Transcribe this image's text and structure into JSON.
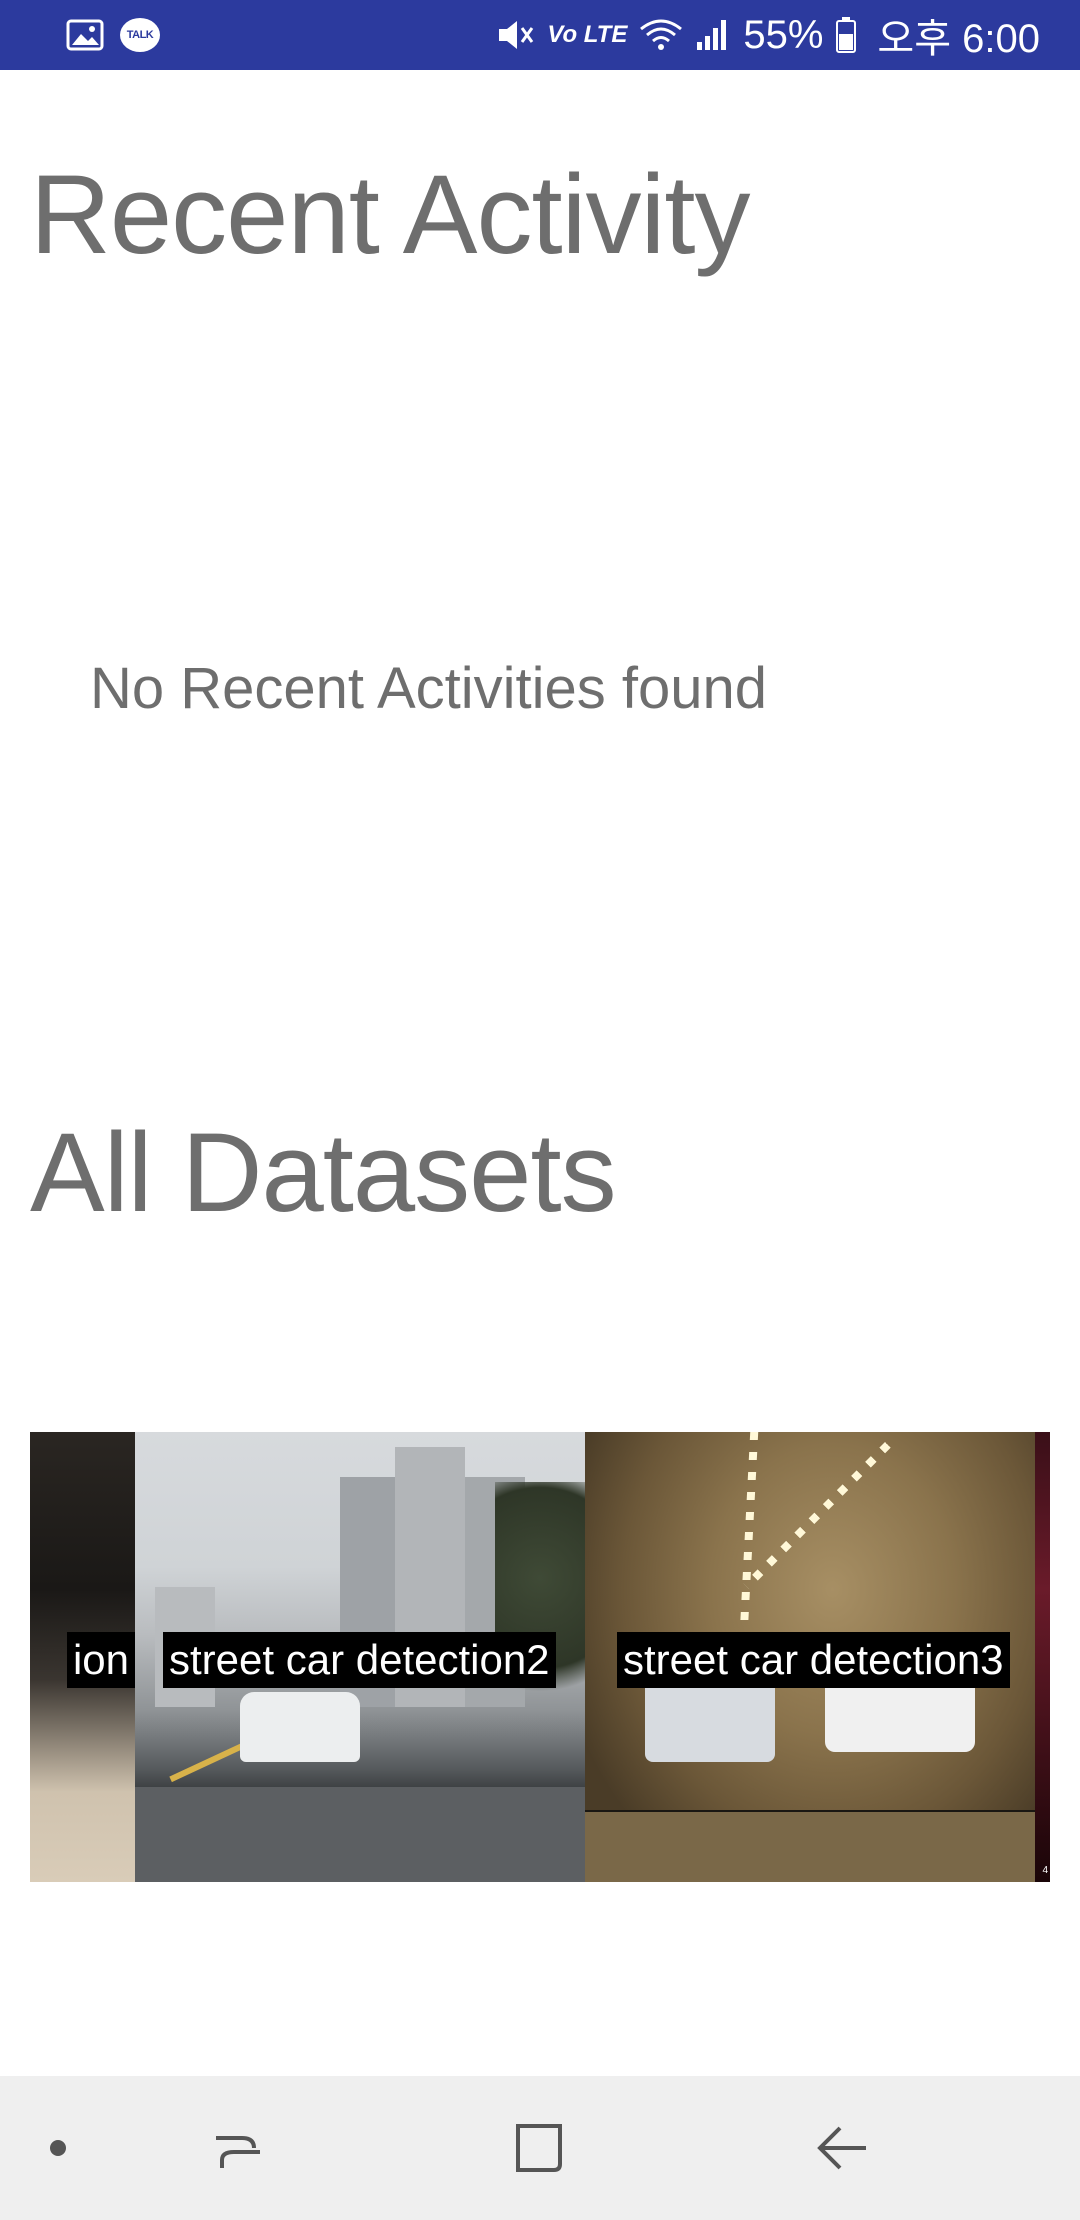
{
  "status_bar": {
    "volte_label": "Vo LTE",
    "battery_percent": "55%",
    "time": "오후 6:00",
    "icons": [
      "gallery-icon",
      "kakaotalk-icon",
      "mute-icon",
      "volte-icon",
      "wifi-icon",
      "signal-icon",
      "battery-icon"
    ],
    "talk_label": "TALK"
  },
  "recent_activity": {
    "title": "Recent Activity",
    "empty_message": "No Recent Activities found"
  },
  "all_datasets": {
    "title": "All Datasets",
    "cards": [
      {
        "caption": "ion"
      },
      {
        "caption": "street car detection2"
      },
      {
        "caption": "street car detection3"
      },
      {
        "caption": "4"
      }
    ]
  },
  "nav_bar": {
    "icons": [
      "dot-icon",
      "recents-icon",
      "home-icon",
      "back-icon"
    ]
  },
  "colors": {
    "status_bar": "#2c3a9e",
    "title_text": "#6e6e6e",
    "nav_bar": "#efefef"
  }
}
